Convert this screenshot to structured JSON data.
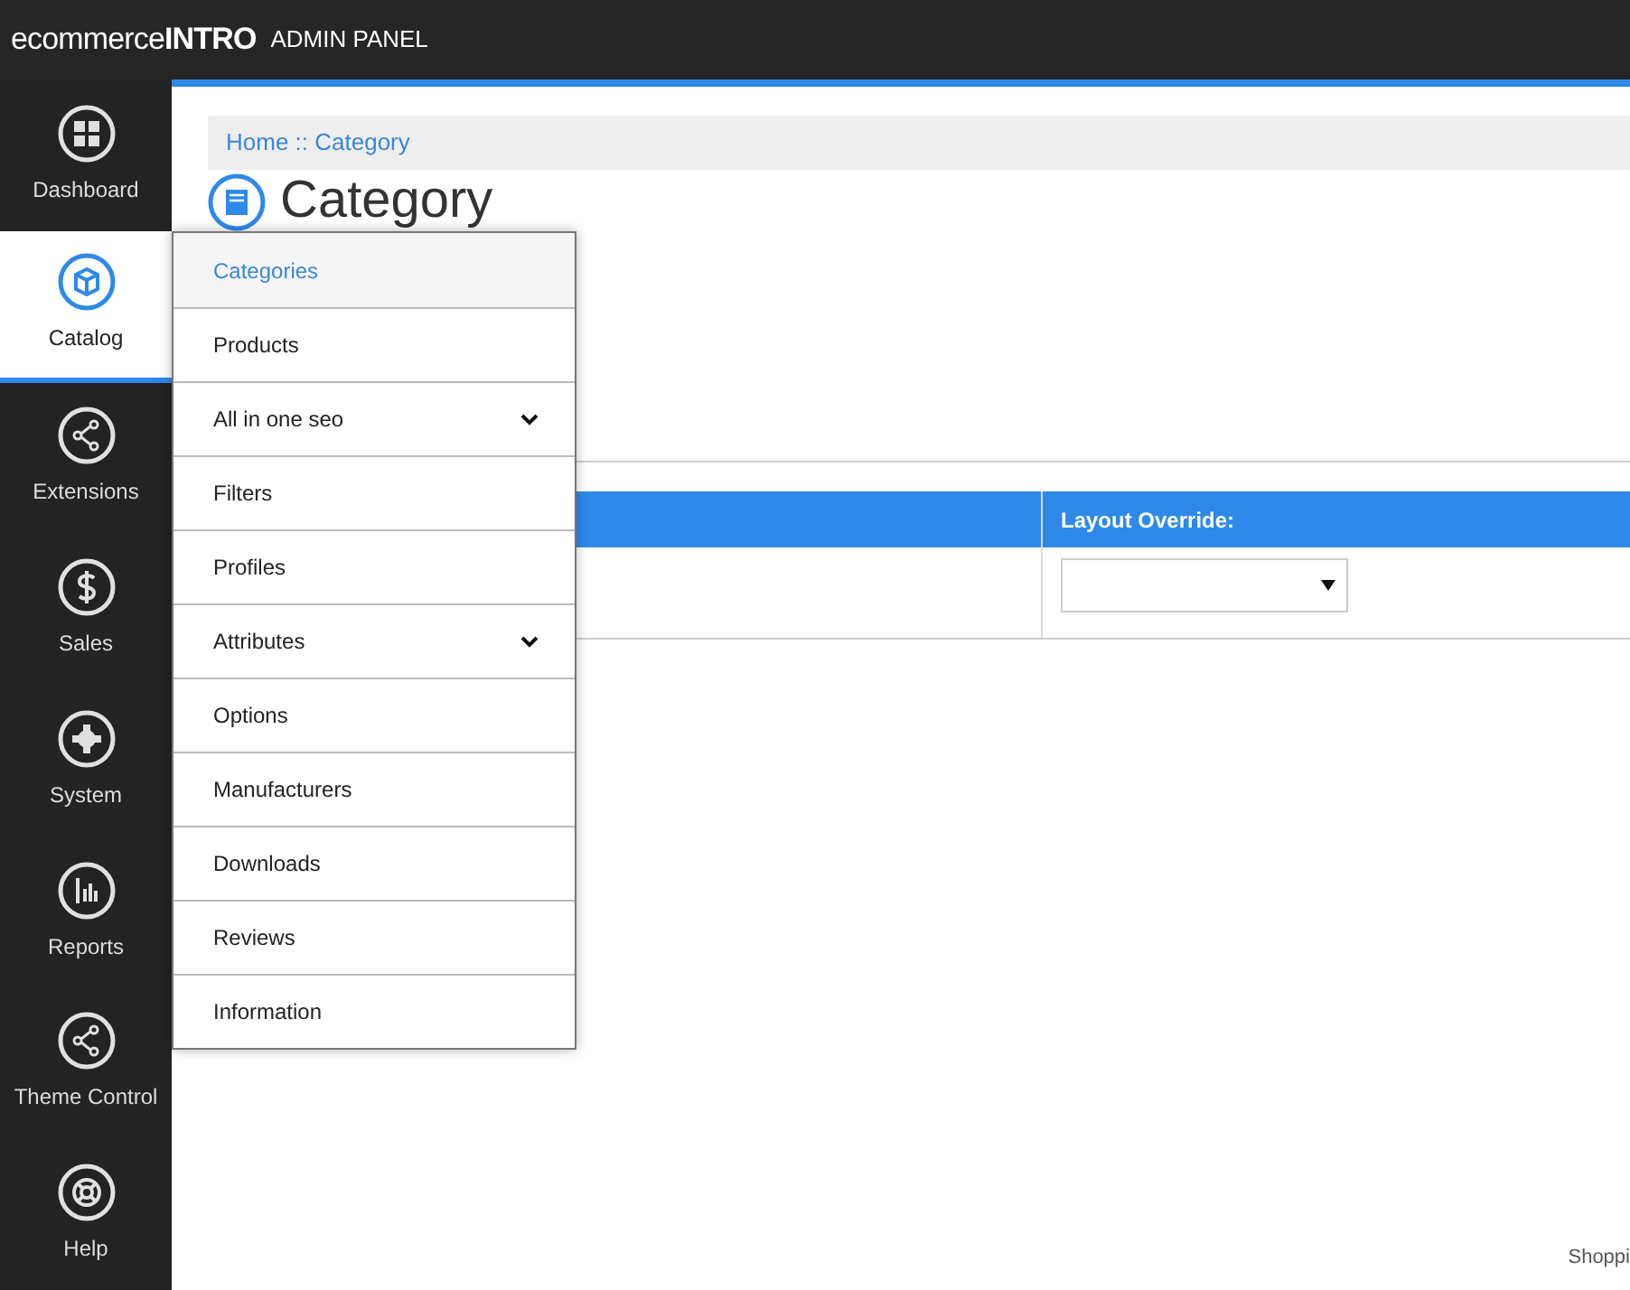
{
  "header": {
    "logo_light": "ecommerce",
    "logo_bold": "INTRO",
    "title": "ADMIN PANEL"
  },
  "sidebar": {
    "items": [
      {
        "label": "Dashboard",
        "selected": false
      },
      {
        "label": "Catalog",
        "selected": true
      },
      {
        "label": "Extensions",
        "selected": false
      },
      {
        "label": "Sales",
        "selected": false
      },
      {
        "label": "System",
        "selected": false
      },
      {
        "label": "Reports",
        "selected": false
      },
      {
        "label": "Theme Control",
        "selected": false
      },
      {
        "label": "Help",
        "selected": false
      }
    ]
  },
  "breadcrumb": "Home :: Category",
  "page_title": "Category",
  "table": {
    "columns": [
      "Layout Override:"
    ]
  },
  "footer": "Shoppi",
  "menu": {
    "items": [
      {
        "label": "Categories",
        "selected": true,
        "has_submenu": false
      },
      {
        "label": "Products",
        "selected": false,
        "has_submenu": false
      },
      {
        "label": "All in one seo",
        "selected": false,
        "has_submenu": true
      },
      {
        "label": "Filters",
        "selected": false,
        "has_submenu": false
      },
      {
        "label": "Profiles",
        "selected": false,
        "has_submenu": false
      },
      {
        "label": "Attributes",
        "selected": false,
        "has_submenu": true
      },
      {
        "label": "Options",
        "selected": false,
        "has_submenu": false
      },
      {
        "label": "Manufacturers",
        "selected": false,
        "has_submenu": false
      },
      {
        "label": "Downloads",
        "selected": false,
        "has_submenu": false
      },
      {
        "label": "Reviews",
        "selected": false,
        "has_submenu": false
      },
      {
        "label": "Information",
        "selected": false,
        "has_submenu": false
      }
    ]
  }
}
